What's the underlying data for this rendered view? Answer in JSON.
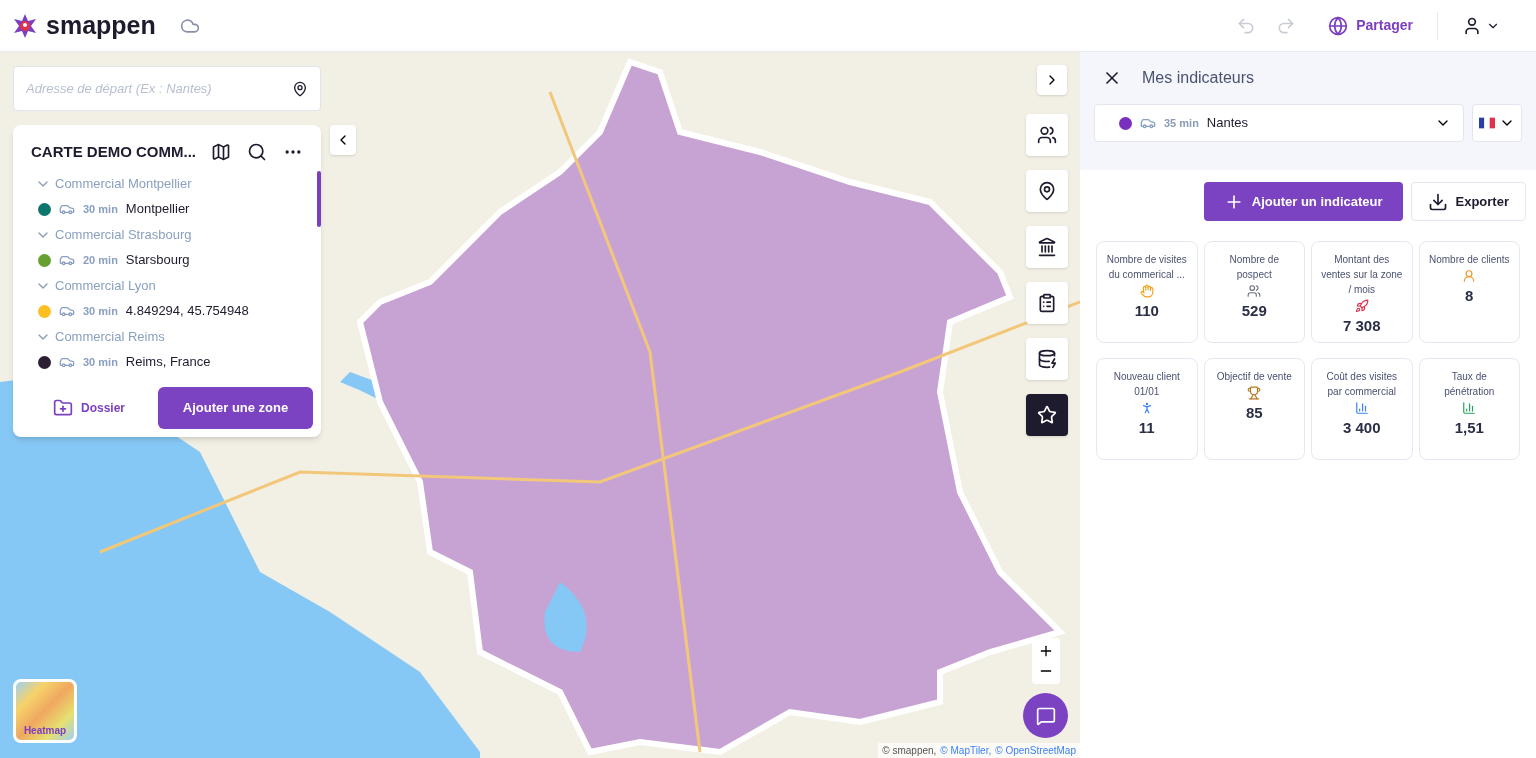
{
  "header": {
    "brand": "smappen",
    "share_label": "Partager"
  },
  "map": {
    "search": {
      "placeholder": "Adresse de départ (Ex : Nantes)"
    },
    "project": {
      "title": "CARTE DEMO COMM...",
      "groups": [
        {
          "name": "Commercial Montpellier",
          "expanded": true,
          "zones": [
            {
              "color": "#0f766e",
              "duration": "30 min",
              "place": "Montpellier"
            }
          ]
        },
        {
          "name": "Commercial Strasbourg",
          "expanded": true,
          "zones": [
            {
              "color": "#65a030",
              "duration": "20 min",
              "place": "Starsbourg"
            }
          ]
        },
        {
          "name": "Commercial Lyon",
          "expanded": true,
          "zones": [
            {
              "color": "#fbbf24",
              "duration": "30 min",
              "place": "4.849294, 45.754948"
            }
          ]
        },
        {
          "name": "Commercial Reims",
          "expanded": true,
          "zones": [
            {
              "color": "#2a1f33",
              "duration": "30 min",
              "place": "Reims, France"
            }
          ]
        }
      ],
      "folder_label": "Dossier",
      "add_zone_label": "Ajouter une zone"
    },
    "tools": [
      {
        "selected": false
      },
      {
        "selected": false
      },
      {
        "selected": false
      },
      {
        "selected": false
      },
      {
        "selected": false
      },
      {
        "selected": true
      }
    ],
    "heatmap_label": "Heatmap",
    "attribution": [
      {
        "text": "© smappen,",
        "link": false
      },
      {
        "text": "© MapTiler,",
        "link": true
      },
      {
        "text": "© OpenStreetMap",
        "link": true
      }
    ]
  },
  "panel": {
    "title": "Mes indicateurs",
    "zone_select": {
      "color": "#7b2fbf",
      "duration": "35 min",
      "place": "Nantes"
    },
    "add_label": "Ajouter un indicateur",
    "export_label": "Exporter",
    "indicators": [
      {
        "label": "Nombre de visites du commerical ...",
        "value": "110"
      },
      {
        "label": "Nombre de pospect",
        "value": "529"
      },
      {
        "label": "Montant des ventes sur la zone / mois",
        "value": "7 308"
      },
      {
        "label": "Nombre de clients",
        "value": "8"
      },
      {
        "label": "Nouveau client 01/01",
        "value": "11"
      },
      {
        "label": "Objectif de vente",
        "value": "85"
      },
      {
        "label": "Coût des visites par commercial",
        "value": "3 400"
      },
      {
        "label": "Taux de pénétration",
        "value": "1,51"
      }
    ]
  }
}
